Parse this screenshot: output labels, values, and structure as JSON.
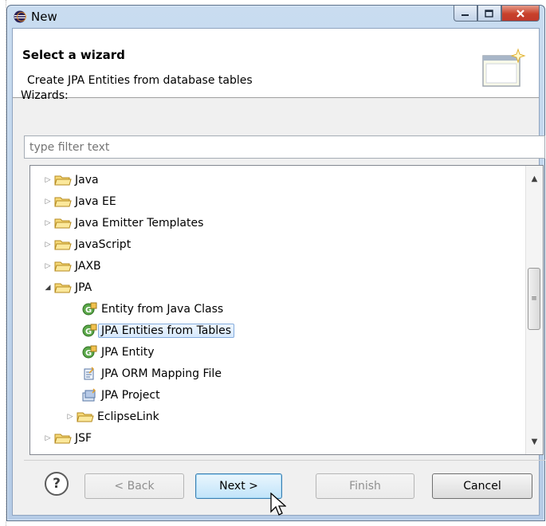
{
  "window": {
    "title": "New",
    "controls": [
      "minimize",
      "maximize",
      "close"
    ]
  },
  "banner": {
    "title": "Select a wizard",
    "description": "Create JPA Entities from database tables"
  },
  "wizards": {
    "label": "Wizards:",
    "filter_placeholder": "type filter text"
  },
  "tree": {
    "items": [
      {
        "label": "Java",
        "state": "collapsed",
        "icon": "folder-icon"
      },
      {
        "label": "Java EE",
        "state": "collapsed",
        "icon": "folder-icon"
      },
      {
        "label": "Java Emitter Templates",
        "state": "collapsed",
        "icon": "folder-icon"
      },
      {
        "label": "JavaScript",
        "state": "collapsed",
        "icon": "folder-icon"
      },
      {
        "label": "JAXB",
        "state": "collapsed",
        "icon": "folder-icon"
      },
      {
        "label": "JPA",
        "state": "expanded",
        "icon": "folder-icon"
      },
      {
        "label": "Entity from Java Class",
        "icon": "jpa-entity-icon"
      },
      {
        "label": "JPA Entities from Tables",
        "icon": "jpa-entity-icon",
        "selected": true
      },
      {
        "label": "JPA Entity",
        "icon": "jpa-entity-icon"
      },
      {
        "label": "JPA ORM Mapping File",
        "icon": "orm-file-icon"
      },
      {
        "label": "JPA Project",
        "icon": "jpa-project-icon"
      },
      {
        "label": "EclipseLink",
        "state": "collapsed",
        "icon": "folder-icon"
      },
      {
        "label": "JSF",
        "state": "collapsed",
        "icon": "folder-icon"
      }
    ]
  },
  "buttons": {
    "help": "?",
    "back": "< Back",
    "next": "Next >",
    "finish": "Finish",
    "cancel": "Cancel"
  }
}
